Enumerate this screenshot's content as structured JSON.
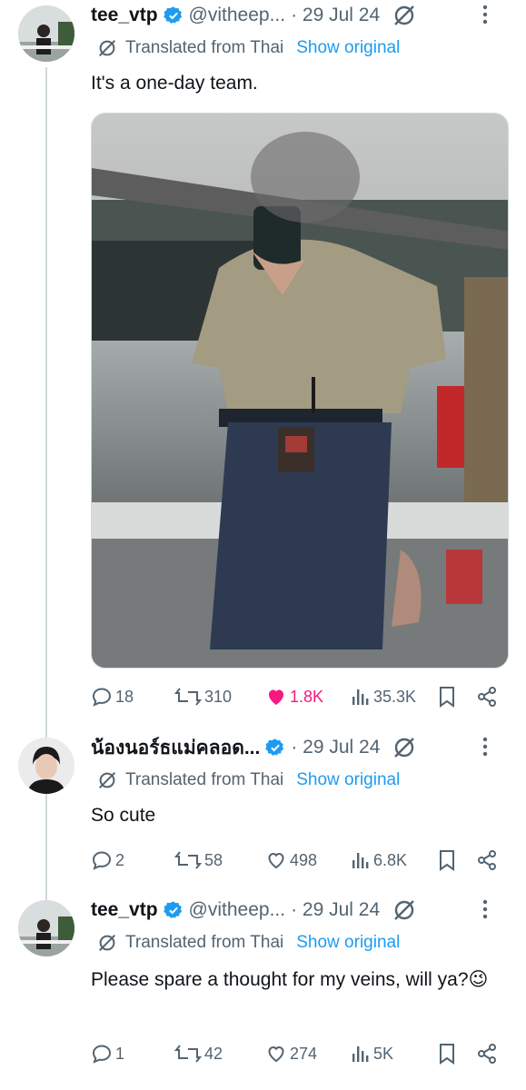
{
  "thread": [
    {
      "author_name": "tee_vtp",
      "handle": "@vitheep...",
      "date": "· 29 Jul 24",
      "translated_label": "Translated from Thai",
      "show_original": "Show original",
      "text": "It's a one-day team.",
      "replies": "18",
      "reposts": "310",
      "likes": "1.8K",
      "views": "35.3K",
      "liked": true
    },
    {
      "author_name": "น้องนอร์ธแม่คลอด...",
      "date": "· 29 Jul 24",
      "translated_label": "Translated from Thai",
      "show_original": "Show original",
      "text": "So cute",
      "replies": "2",
      "reposts": "58",
      "likes": "498",
      "views": "6.8K",
      "liked": false
    },
    {
      "author_name": "tee_vtp",
      "handle": "@vitheep...",
      "date": "· 29 Jul 24",
      "translated_label": "Translated from Thai",
      "show_original": "Show original",
      "text": "Please spare a thought for my veins, will ya?😉",
      "replies": "1",
      "reposts": "42",
      "likes": "274",
      "views": "5K",
      "liked": false
    }
  ],
  "colors": {
    "link": "#1d9bf0",
    "muted": "#536471",
    "like": "#f91880",
    "verified": "#1d9bf0"
  }
}
